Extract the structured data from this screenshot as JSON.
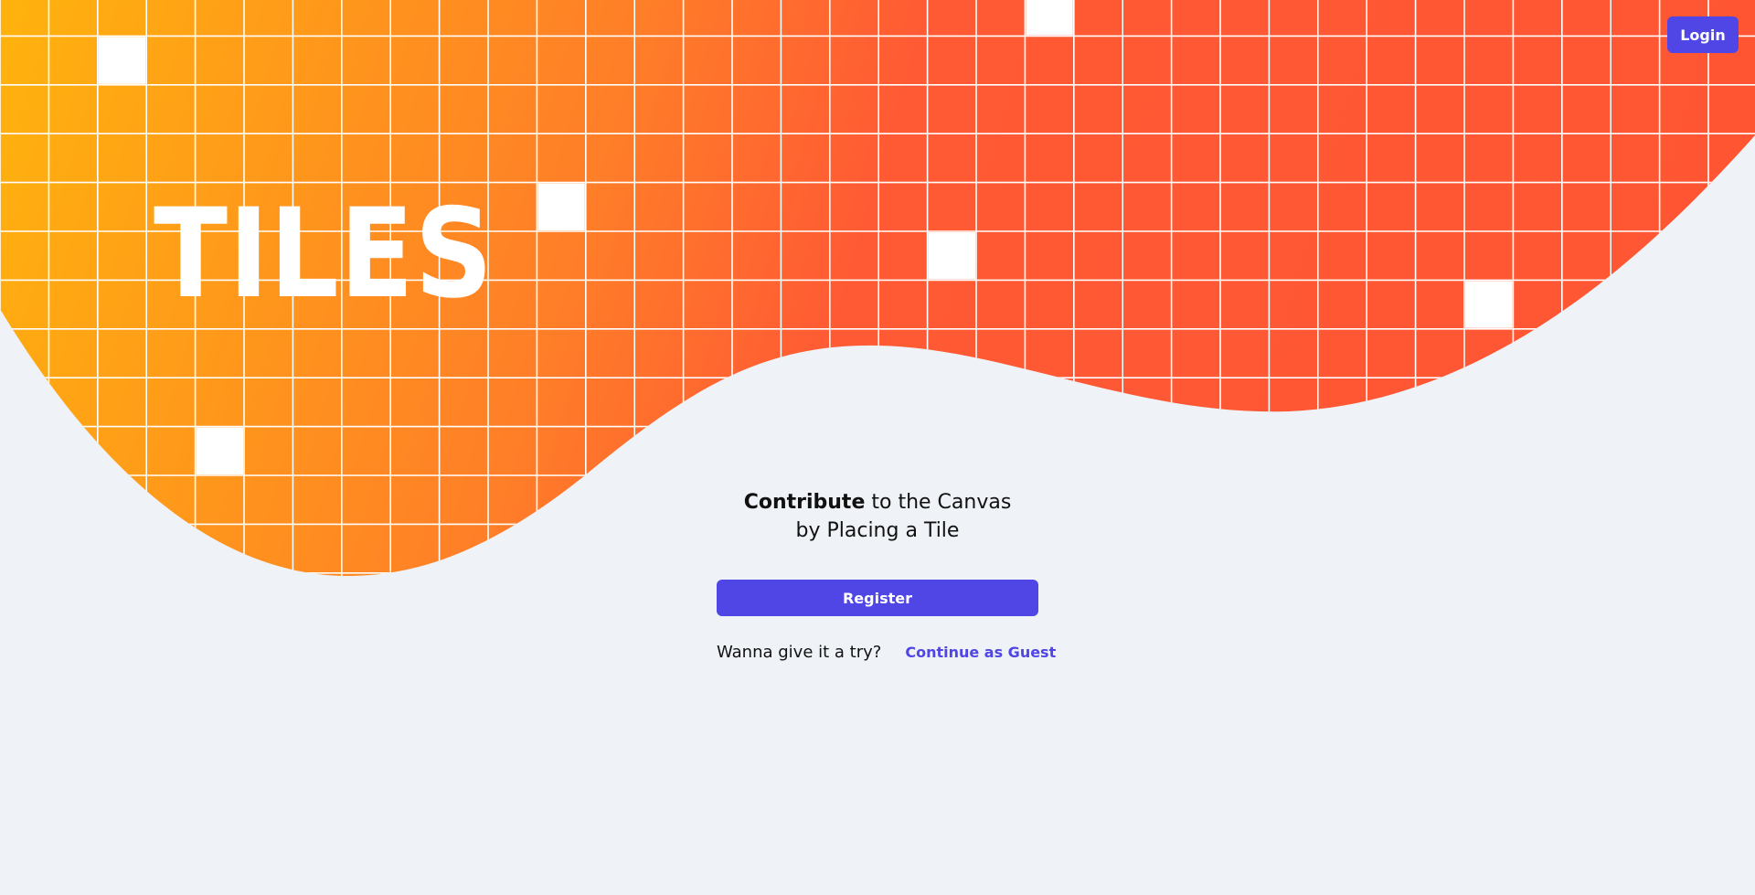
{
  "header": {
    "login_label": "Login"
  },
  "hero": {
    "brand_title": "TILES",
    "gradient_start": "#ffb30d",
    "gradient_mid": "#ff7a2a",
    "gradient_end": "#ff5533",
    "grid_line_color": "#ffffff",
    "placed_tile_color": "#ffffff"
  },
  "main": {
    "headline_bold": "Contribute",
    "headline_rest": " to the Canvas",
    "headline_line2": "by Placing a Tile",
    "register_label": "Register",
    "guest_prompt": "Wanna give it a try?",
    "guest_link_label": "Continue as Guest"
  },
  "theme": {
    "accent": "#4f46e5",
    "background": "#eff2f6"
  }
}
